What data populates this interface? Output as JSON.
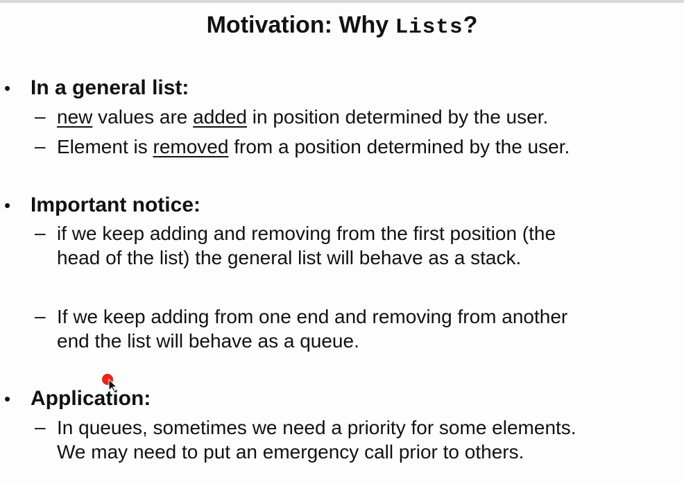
{
  "title": {
    "prefix": "Motivation: Why ",
    "code": "Lists",
    "suffix": "?"
  },
  "bullets": [
    {
      "marker": "•",
      "heading": "In a general list:",
      "items": [
        {
          "dash": "–",
          "lines": [
            [
              {
                "text": "new",
                "underline": true
              },
              {
                "text": " values are ",
                "underline": false
              },
              {
                "text": "added",
                "underline": true
              },
              {
                "text": " in position determined by the user.",
                "underline": false
              }
            ]
          ]
        },
        {
          "dash": "–",
          "lines": [
            [
              {
                "text": "Element is ",
                "underline": false
              },
              {
                "text": "removed",
                "underline": true
              },
              {
                "text": " from a position determined by the user.",
                "underline": false
              }
            ]
          ]
        }
      ]
    },
    {
      "marker": "•",
      "heading": "Important notice:",
      "items": [
        {
          "dash": "–",
          "lines": [
            [
              {
                "text": "if we keep adding and removing from the first position (the",
                "underline": false
              }
            ],
            [
              {
                "text": "head of the list) the general list will behave as a stack.",
                "underline": false
              }
            ]
          ]
        },
        {
          "dash": "–",
          "lines": [
            [
              {
                "text": "If we keep adding from one end and removing from another",
                "underline": false
              }
            ],
            [
              {
                "text": "end the list will behave as a queue.",
                "underline": false
              }
            ]
          ]
        }
      ]
    },
    {
      "marker": "•",
      "heading": "Application:",
      "items": [
        {
          "dash": "–",
          "lines": [
            [
              {
                "text": "In queues, sometimes we need a priority for some elements.",
                "underline": false
              }
            ],
            [
              {
                "text": "We may need to put an emergency call prior to others.",
                "underline": false
              }
            ]
          ]
        }
      ]
    }
  ],
  "colors": {
    "text": "#111111",
    "background": "#fdfdfd",
    "pointer_dot": "#e8231a"
  },
  "icons": {
    "pointer": "mouse-pointer-icon",
    "highlight": "laser-pointer-dot-icon"
  }
}
